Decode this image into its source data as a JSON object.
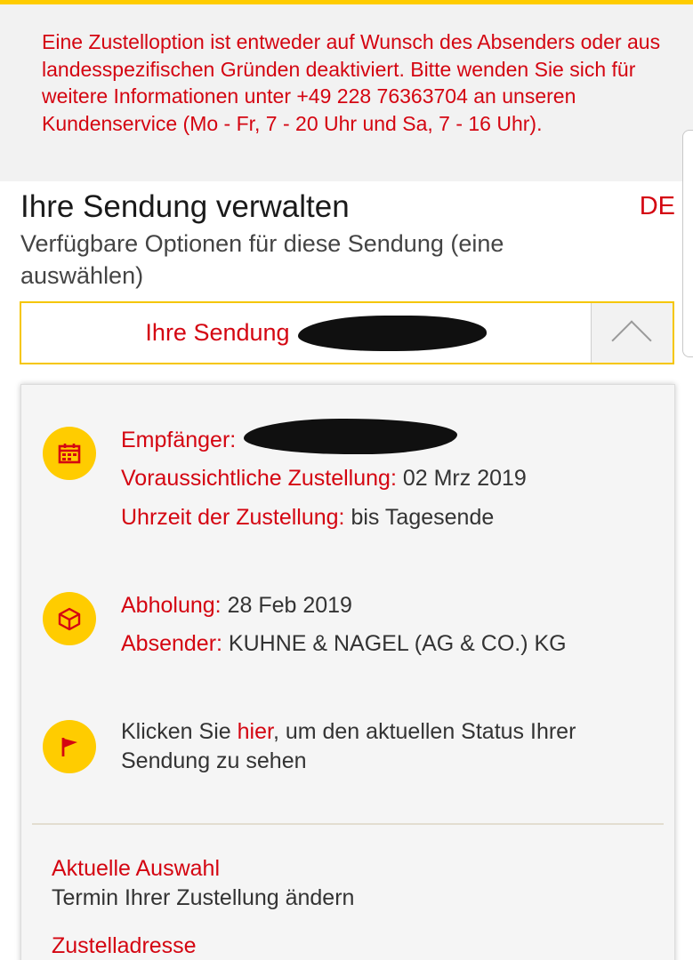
{
  "notice": {
    "text": "Eine Zustelloption ist entweder auf Wunsch des Absenders oder aus landesspezifischen Gründen deaktiviert. Bitte wenden Sie sich für weitere Informationen unter +49 228 76363704 an unseren Kundenservice (Mo - Fr, 7 - 20 Uhr und Sa, 7 - 16 Uhr)."
  },
  "header": {
    "title": "Ihre Sendung verwalten",
    "language": "DE",
    "subtitle": "Verfügbare Optionen für diese Sendung (eine auswählen)"
  },
  "shipment_select": {
    "label": "Ihre Sendung"
  },
  "delivery": {
    "recipient_label": "Empfänger:",
    "eta_label": "Voraussichtliche Zustellung:",
    "eta_value": "02 Mrz 2019",
    "time_label": "Uhrzeit der Zustellung:",
    "time_value": "bis Tagesende"
  },
  "pickup": {
    "pickup_label": "Abholung:",
    "pickup_value": "28 Feb 2019",
    "sender_label": "Absender:",
    "sender_value": "KUHNE & NAGEL (AG & CO.) KG"
  },
  "status": {
    "prefix": "Klicken Sie ",
    "link": "hier",
    "suffix": ", um den aktuellen Status Ihrer",
    "line2": "Sendung zu sehen"
  },
  "selection": {
    "current_heading": "Aktuelle Auswahl",
    "current_value": "Termin Ihrer Zustellung ändern",
    "address_heading": "Zustelladresse"
  },
  "icons": {
    "delivery": "calendar-icon",
    "pickup": "package-icon",
    "status": "flag-icon"
  },
  "colors": {
    "brand_red": "#d40511",
    "brand_yellow": "#ffcc00"
  }
}
